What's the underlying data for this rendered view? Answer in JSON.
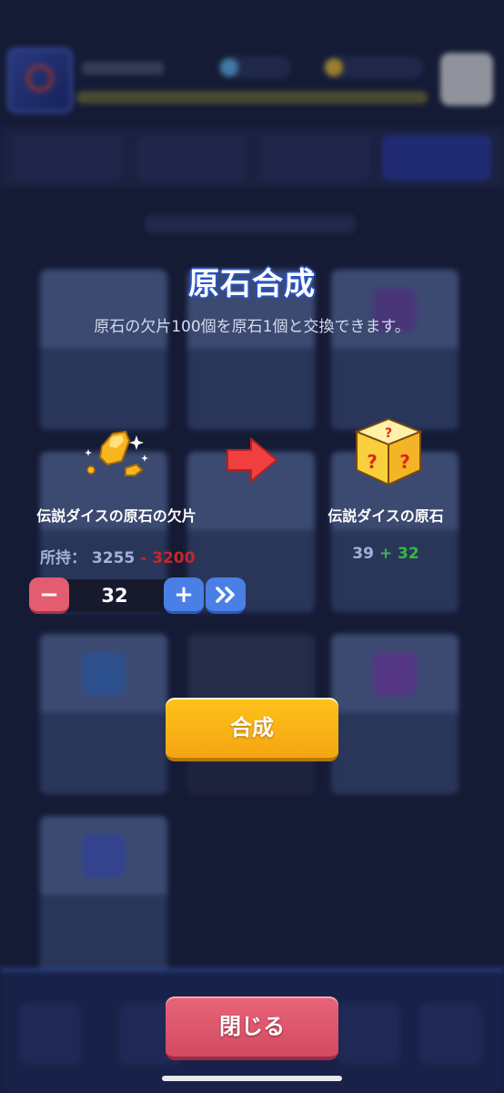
{
  "modal": {
    "title": "原石合成",
    "subtitle": "原石の欠片100個を原石1個と交換できます。"
  },
  "source_item": {
    "name": "伝説ダイスの原石の欠片",
    "owned_label": "所持：",
    "owned_value": "3255",
    "cost": "- 3200",
    "icon": "gold-ore-shard-icon"
  },
  "target_item": {
    "name": "伝説ダイスの原石",
    "owned_value": "39",
    "gain": "+ 32",
    "icon": "mystery-dice-icon"
  },
  "stepper": {
    "quantity": "32",
    "minus_label": "−",
    "plus_label": "+",
    "max_icon": "double-chevron-right-icon"
  },
  "buttons": {
    "synthesize": "合成",
    "close": "閉じる"
  },
  "colors": {
    "title_outline": "#2b4fb5",
    "cost_red": "#c8262a",
    "gain_green": "#35b846",
    "synth_yellow": "#f3a512",
    "close_pink": "#d24a62",
    "stepper_blue": "#4a7fe6",
    "stepper_minus": "#e25d6f"
  }
}
